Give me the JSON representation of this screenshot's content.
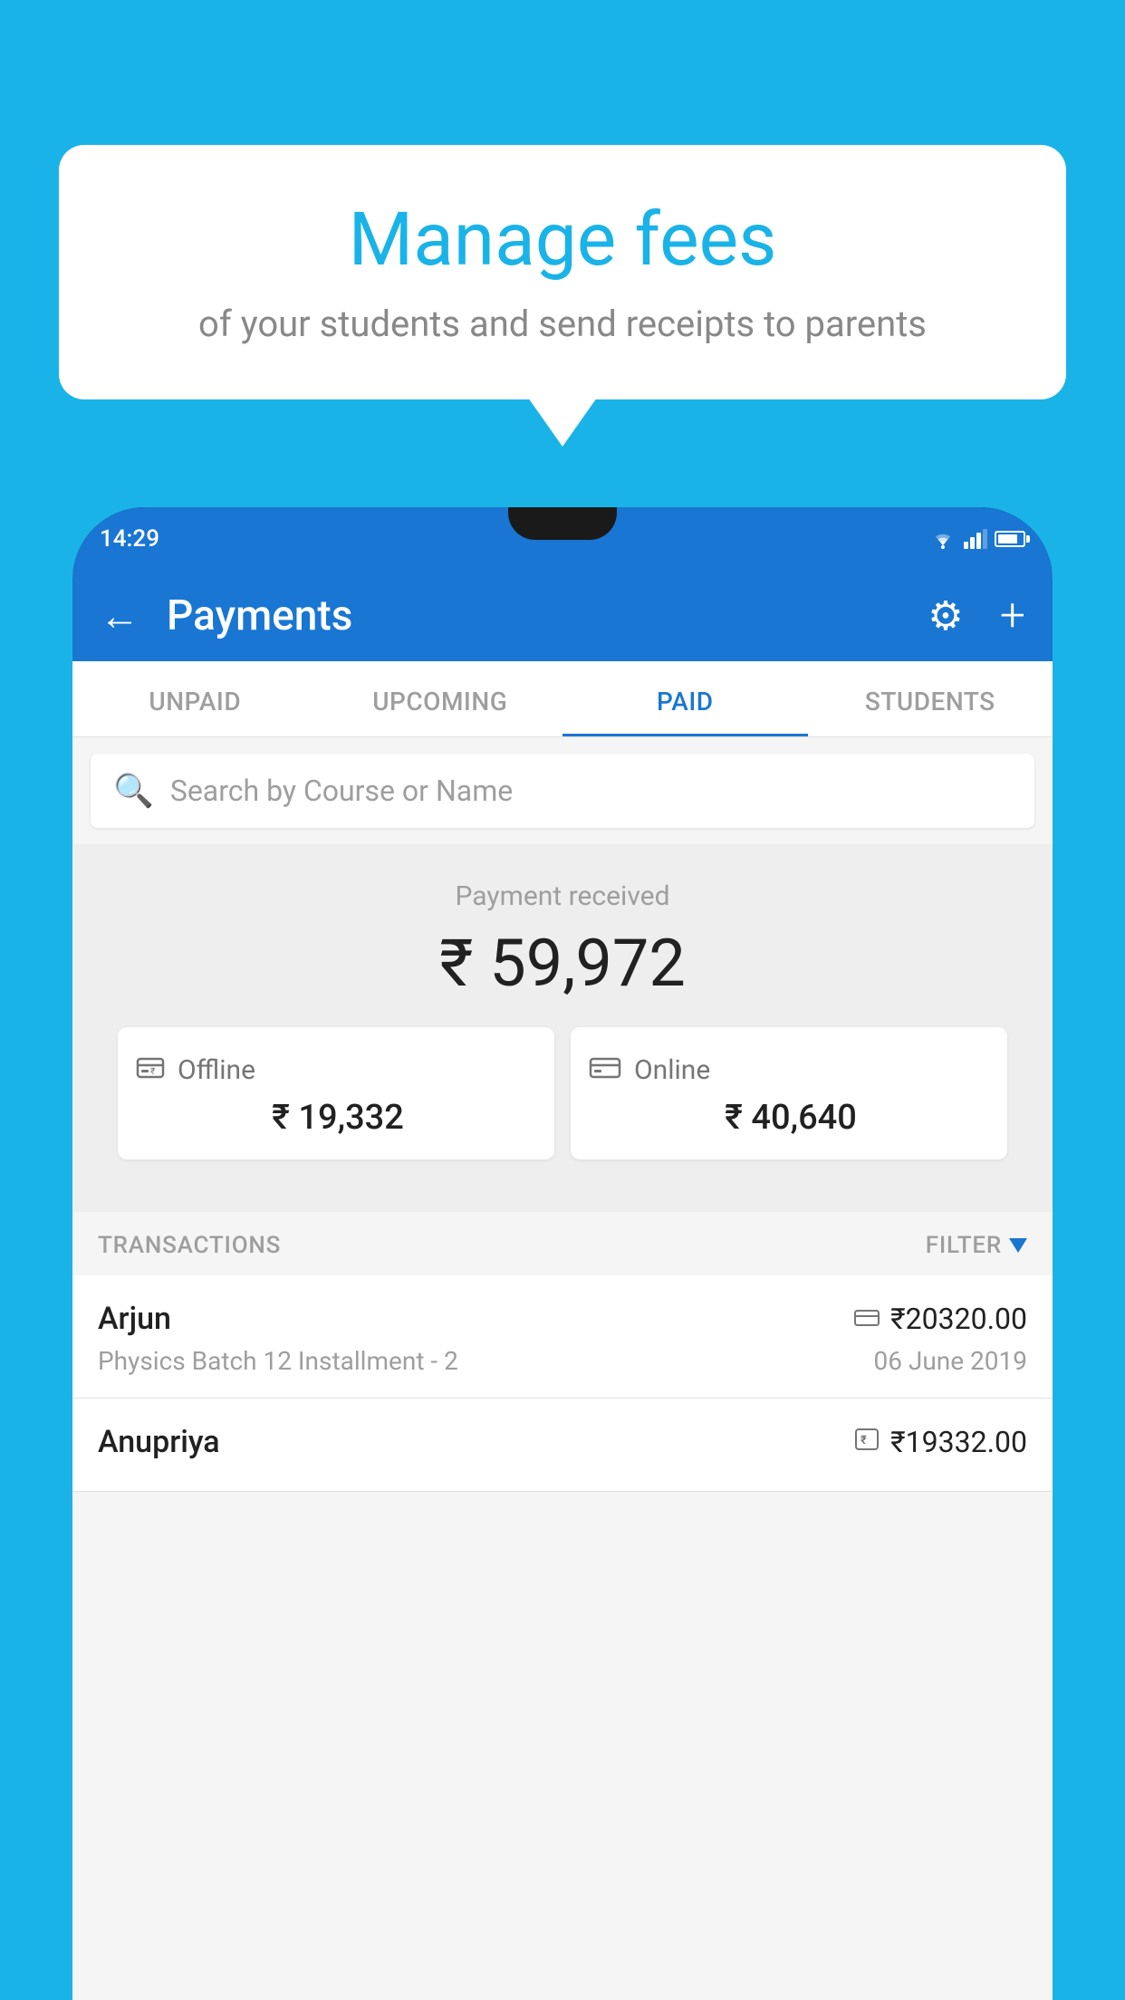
{
  "background_color": "#1ab3e8",
  "bubble": {
    "title": "Manage fees",
    "subtitle": "of your students and send receipts to parents"
  },
  "phone": {
    "status_bar": {
      "time": "14:29"
    },
    "header": {
      "title": "Payments",
      "back_label": "←",
      "gear_label": "⚙",
      "plus_label": "+"
    },
    "tabs": [
      {
        "label": "UNPAID",
        "active": false
      },
      {
        "label": "UPCOMING",
        "active": false
      },
      {
        "label": "PAID",
        "active": true
      },
      {
        "label": "STUDENTS",
        "active": false
      }
    ],
    "search": {
      "placeholder": "Search by Course or Name"
    },
    "payment_received": {
      "label": "Payment received",
      "amount": "₹ 59,972",
      "offline": {
        "label": "Offline",
        "amount": "₹ 19,332"
      },
      "online": {
        "label": "Online",
        "amount": "₹ 40,640"
      }
    },
    "transactions": {
      "header_label": "TRANSACTIONS",
      "filter_label": "FILTER",
      "items": [
        {
          "name": "Arjun",
          "course": "Physics Batch 12 Installment - 2",
          "amount": "₹20320.00",
          "date": "06 June 2019",
          "payment_type": "card"
        },
        {
          "name": "Anupriya",
          "course": "",
          "amount": "₹19332.00",
          "date": "",
          "payment_type": "cash"
        }
      ]
    }
  }
}
